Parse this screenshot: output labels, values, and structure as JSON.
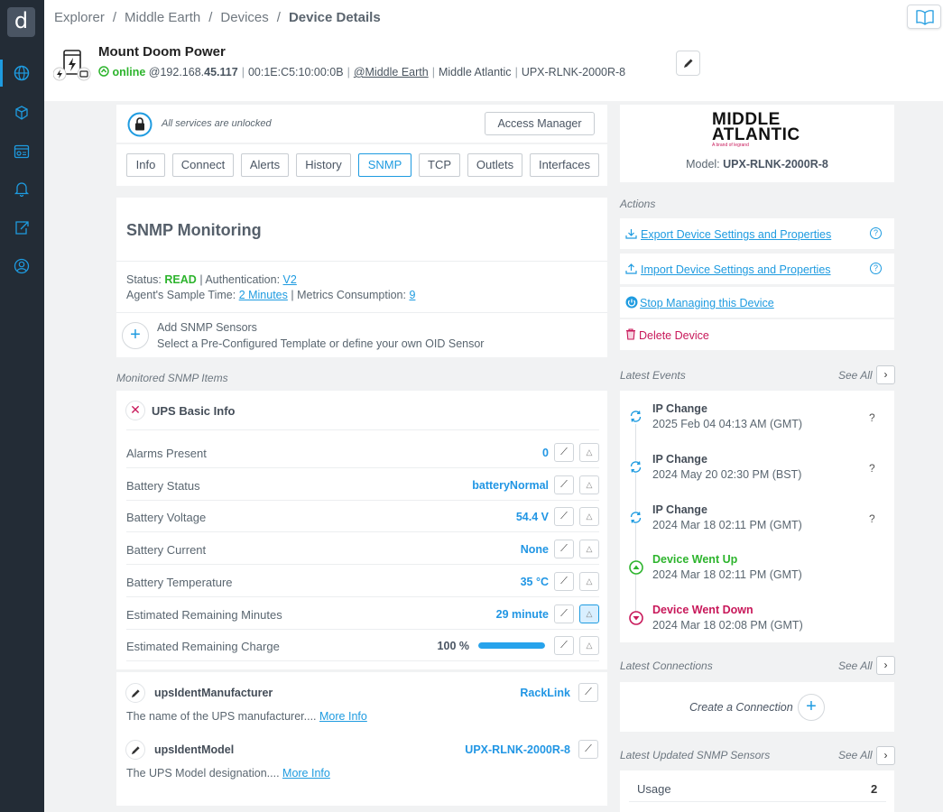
{
  "sidebar": {
    "logo": "d",
    "icons": [
      "globe-icon",
      "cubes-icon",
      "dashboard-icon",
      "bell-icon",
      "export-icon",
      "user-icon"
    ]
  },
  "breadcrumb": {
    "items": [
      "Explorer",
      "Middle Earth",
      "Devices"
    ],
    "current": "Device Details",
    "sep": "/"
  },
  "device": {
    "name": "Mount Doom Power",
    "status": "online",
    "ip_prefix": "@192.168.",
    "ip_bold": "45.117",
    "mac": "00:1E:C5:10:00:0B",
    "network": "@Middle Earth",
    "brand": "Middle Atlantic",
    "model": "UPX-RLNK-2000R-8"
  },
  "lock": {
    "text": "All services are unlocked",
    "access_button": "Access Manager"
  },
  "tabs": [
    "Info",
    "Connect",
    "Alerts",
    "History",
    "SNMP",
    "TCP",
    "Outlets",
    "Interfaces"
  ],
  "active_tab": "SNMP",
  "snmp": {
    "title": "SNMP Monitoring",
    "status_label": "Status:",
    "status_value": "READ",
    "auth_label": "| Authentication:",
    "auth_value": "V2",
    "sample_label": "Agent's Sample Time:",
    "sample_value": "2 Minutes",
    "metrics_label": "| Metrics Consumption:",
    "metrics_value": "9",
    "add_title": "Add SNMP Sensors",
    "add_desc": "Select a Pre-Configured Template or define your own OID Sensor"
  },
  "monitored": {
    "label": "Monitored SNMP Items",
    "group": "UPS Basic Info",
    "rows": [
      {
        "label": "Alarms Present",
        "value": "0"
      },
      {
        "label": "Battery Status",
        "value": "batteryNormal"
      },
      {
        "label": "Battery Voltage",
        "value": "54.4 V"
      },
      {
        "label": "Battery Current",
        "value": "None"
      },
      {
        "label": "Battery Temperature",
        "value": "35 °C"
      },
      {
        "label": "Estimated Remaining Minutes",
        "value": "29 minute"
      },
      {
        "label": "Estimated Remaining Charge",
        "value": "100 %",
        "progress": 100
      }
    ]
  },
  "oids": [
    {
      "name": "upsIdentManufacturer",
      "value": "RackLink",
      "desc": "The name of the UPS manufacturer....",
      "more": "More Info"
    },
    {
      "name": "upsIdentModel",
      "value": "UPX-RLNK-2000R-8",
      "desc": "The UPS Model designation....",
      "more": "More Info"
    }
  ],
  "brand_card": {
    "logo_line1": "MIDDLE",
    "logo_line2": "ATLANTIC",
    "logo_sub": "A brand of legrand",
    "model_label": "Model:",
    "model_value": "UPX-RLNK-2000R-8"
  },
  "actions": {
    "label": "Actions",
    "export": "Export Device Settings and Properties",
    "import": "Import Device Settings and Properties",
    "stop": "Stop Managing this Device",
    "delete": "Delete Device"
  },
  "events": {
    "label": "Latest Events",
    "see_all": "See All",
    "items": [
      {
        "title": "IP Change",
        "date": "2025 Feb 04 04:13 AM (GMT)",
        "q": "?",
        "kind": "ip"
      },
      {
        "title": "IP Change",
        "date": "2024 May 20 02:30 PM (BST)",
        "q": "?",
        "kind": "ip"
      },
      {
        "title": "IP Change",
        "date": "2024 Mar 18 02:11 PM (GMT)",
        "q": "?",
        "kind": "ip"
      },
      {
        "title": "Device Went Up",
        "date": "2024 Mar 18 02:11 PM (GMT)",
        "q": "",
        "kind": "up"
      },
      {
        "title": "Device Went Down",
        "date": "2024 Mar 18 02:08 PM (GMT)",
        "q": "",
        "kind": "down"
      }
    ]
  },
  "connections": {
    "label": "Latest Connections",
    "see_all": "See All",
    "create": "Create a Connection"
  },
  "sensors": {
    "label": "Latest Updated SNMP Sensors",
    "see_all": "See All",
    "items": [
      {
        "name": "Usage",
        "value": "2"
      }
    ]
  },
  "colors": {
    "accent": "#1e9be0",
    "online": "#2db42d",
    "danger": "#c8185a",
    "sidebar": "#232c36"
  }
}
